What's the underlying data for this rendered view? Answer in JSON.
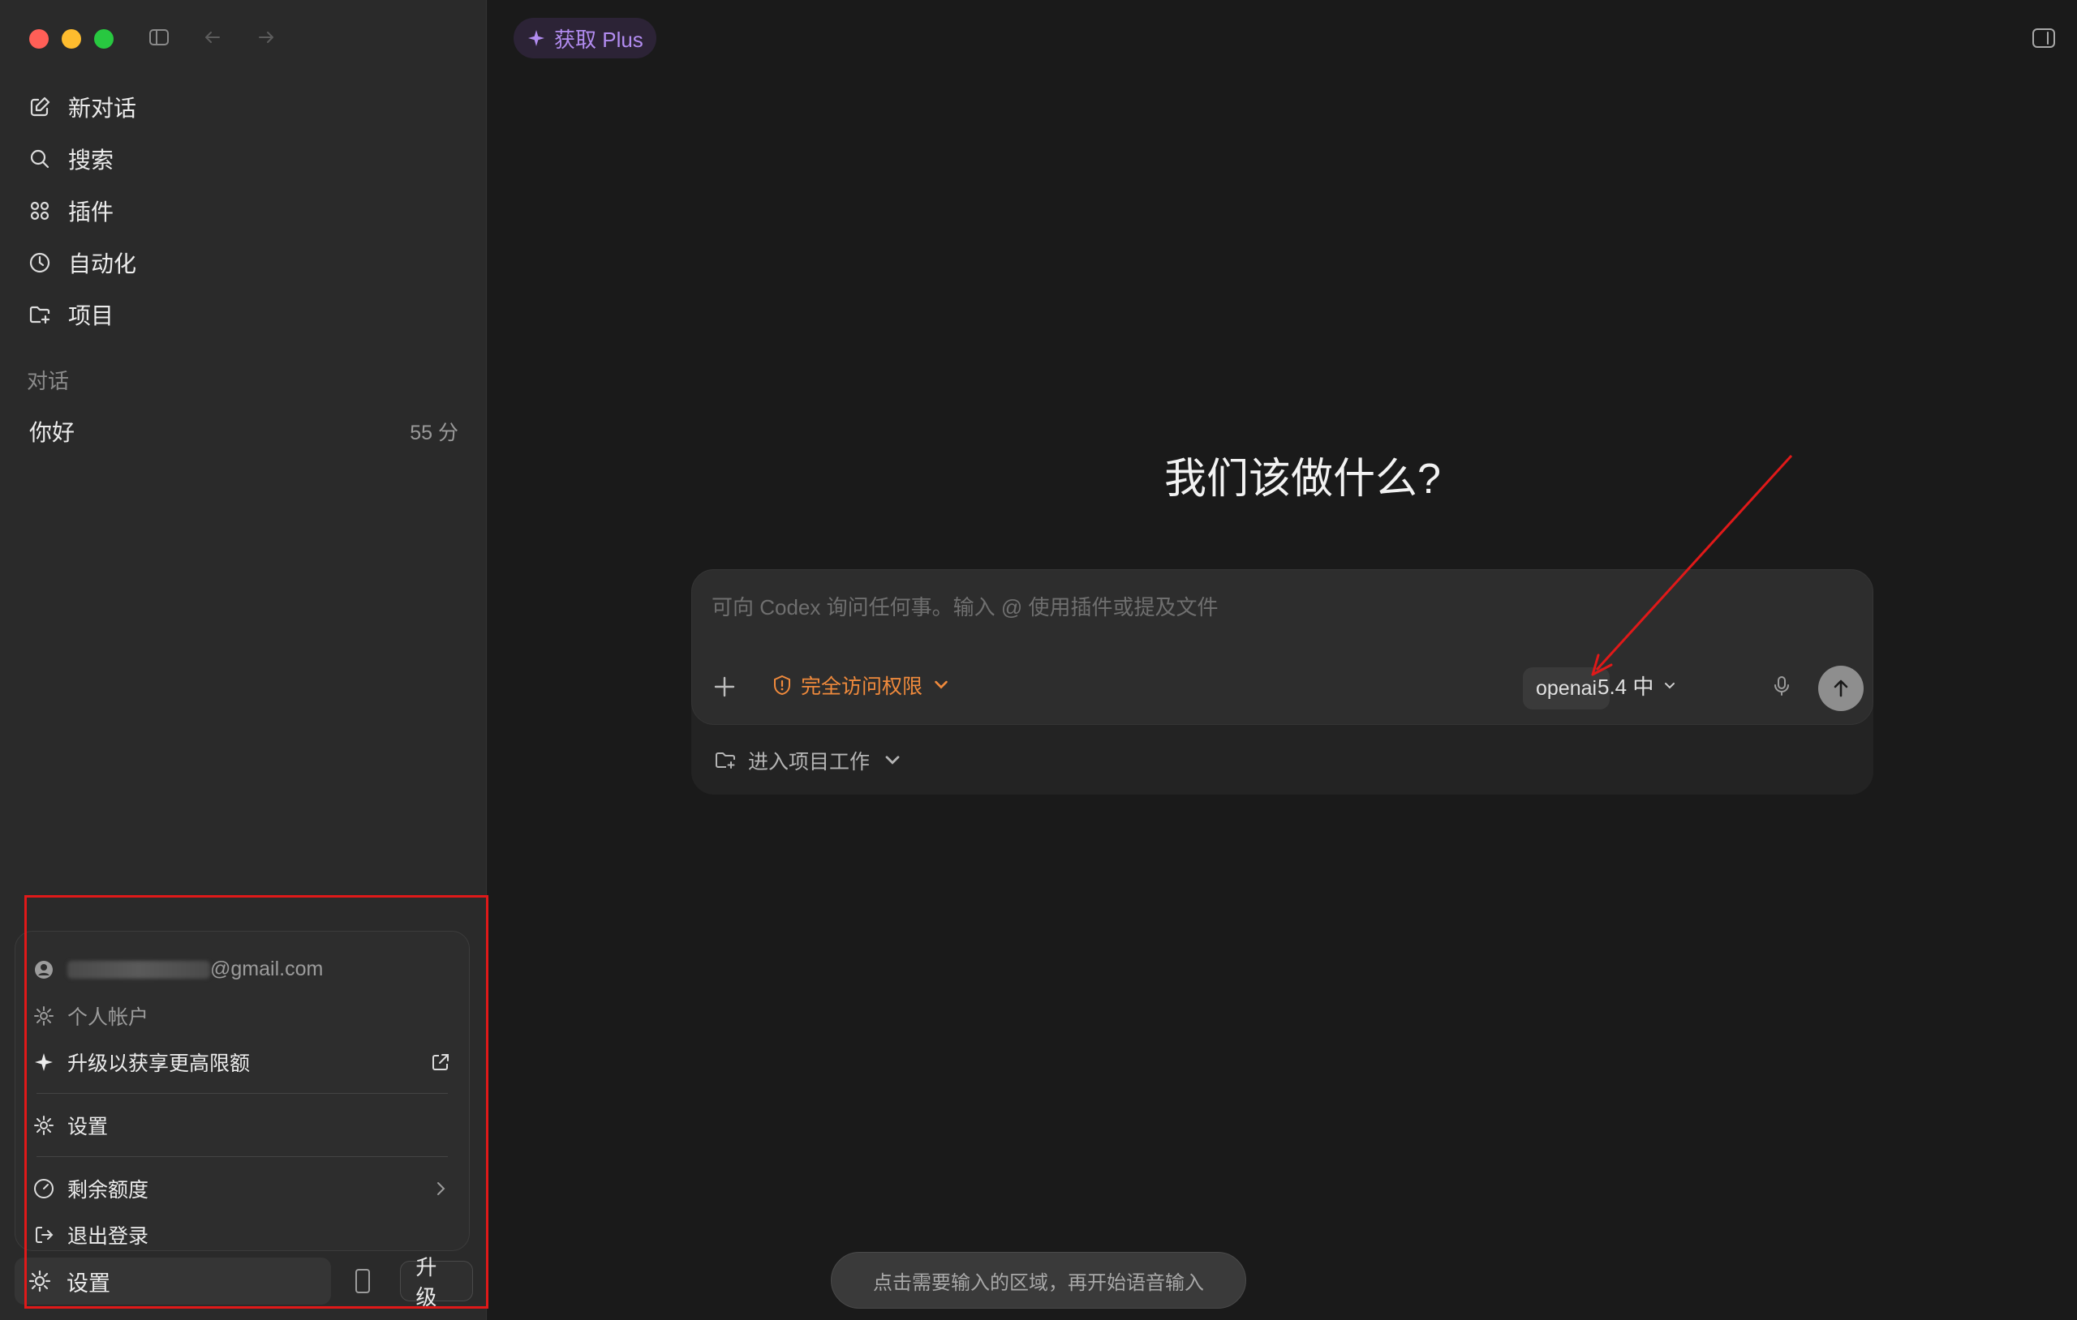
{
  "sidebar": {
    "nav": [
      {
        "label": "新对话",
        "icon": "compose-icon"
      },
      {
        "label": "搜索",
        "icon": "search-icon"
      },
      {
        "label": "插件",
        "icon": "plugins-icon"
      },
      {
        "label": "自动化",
        "icon": "clock-icon"
      },
      {
        "label": "项目",
        "icon": "folder-add-icon"
      }
    ],
    "section_label": "对话",
    "conversations": [
      {
        "title": "你好",
        "time": "55 分"
      }
    ]
  },
  "menu": {
    "email_suffix": "@gmail.com",
    "personal_account": "个人帐户",
    "upgrade_limits": "升级以获享更高限额",
    "settings": "设置",
    "remaining_quota": "剩余额度",
    "logout": "退出登录"
  },
  "bottom": {
    "settings_label": "设置",
    "upgrade_label": "升级"
  },
  "main": {
    "plus_pill": "获取 Plus",
    "headline": "我们该做什么?",
    "composer": {
      "placeholder": "可向 Codex 询问任何事。输入 @ 使用插件或提及文件",
      "access_label": "完全访问权限",
      "model_label": "openai",
      "version_label": "5.4 中"
    },
    "project_label": "进入项目工作",
    "voice_tip": "点击需要输入的区域，再开始语音输入"
  },
  "colors": {
    "accent_purple": "#b28cf0",
    "access_orange": "#f08a3c",
    "annotation_red": "#e01919"
  }
}
